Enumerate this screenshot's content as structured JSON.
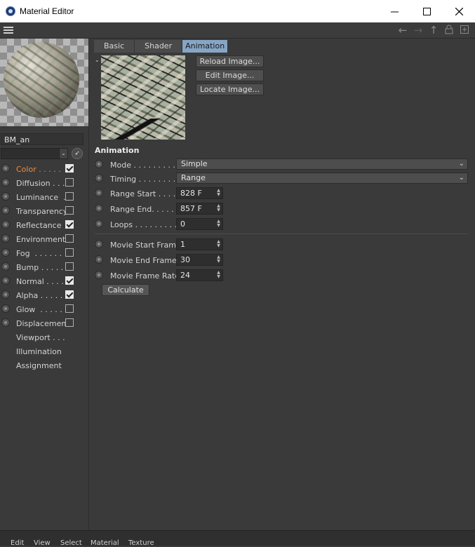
{
  "window": {
    "title": "Material Editor"
  },
  "material": {
    "name": "BM_an"
  },
  "channels": [
    {
      "label": "Color . . . . .",
      "checked": true,
      "active": true
    },
    {
      "label": "Diffusion . . .",
      "checked": false
    },
    {
      "label": "Luminance  .",
      "checked": false
    },
    {
      "label": "Transparency",
      "checked": false
    },
    {
      "label": "Reflectance",
      "checked": true
    },
    {
      "label": "Environment",
      "checked": false
    },
    {
      "label": "Fog  . . . . . .",
      "checked": false
    },
    {
      "label": "Bump . . . . .",
      "checked": false
    },
    {
      "label": "Normal . . . .",
      "checked": true
    },
    {
      "label": "Alpha . . . . .",
      "checked": true
    },
    {
      "label": "Glow  . . . . .",
      "checked": false
    },
    {
      "label": "Displacement",
      "checked": false
    }
  ],
  "extra_items": [
    "Viewport . . .",
    "Illumination",
    "Assignment"
  ],
  "tabs": [
    "Basic",
    "Shader",
    "Animation"
  ],
  "image_buttons": [
    "Reload Image...",
    "Edit Image...",
    "Locate Image..."
  ],
  "section_title": "Animation",
  "params": {
    "mode": {
      "label": "Mode . . . . . . . . .",
      "value": "Simple"
    },
    "timing": {
      "label": "Timing . . . . . . . .",
      "value": "Range"
    },
    "range_start": {
      "label": "Range Start . . . .",
      "value": "828 F"
    },
    "range_end": {
      "label": "Range End. . . . .",
      "value": "857 F"
    },
    "loops": {
      "label": "Loops . . . . . . . . .",
      "value": "0"
    },
    "movie_start": {
      "label": "Movie Start Frame",
      "value": "1"
    },
    "movie_end": {
      "label": "Movie End Frame",
      "value": "30"
    },
    "movie_rate": {
      "label": "Movie Frame Rate",
      "value": "24"
    }
  },
  "calculate_label": "Calculate",
  "bottom_menu": [
    "Edit",
    "View",
    "Select",
    "Material",
    "Texture"
  ],
  "icons": [
    "app-icon",
    "hamburger-icon",
    "arrow-left-icon",
    "arrow-right-icon",
    "arrow-up-icon",
    "lock-icon",
    "new-window-icon",
    "picker-icon"
  ]
}
